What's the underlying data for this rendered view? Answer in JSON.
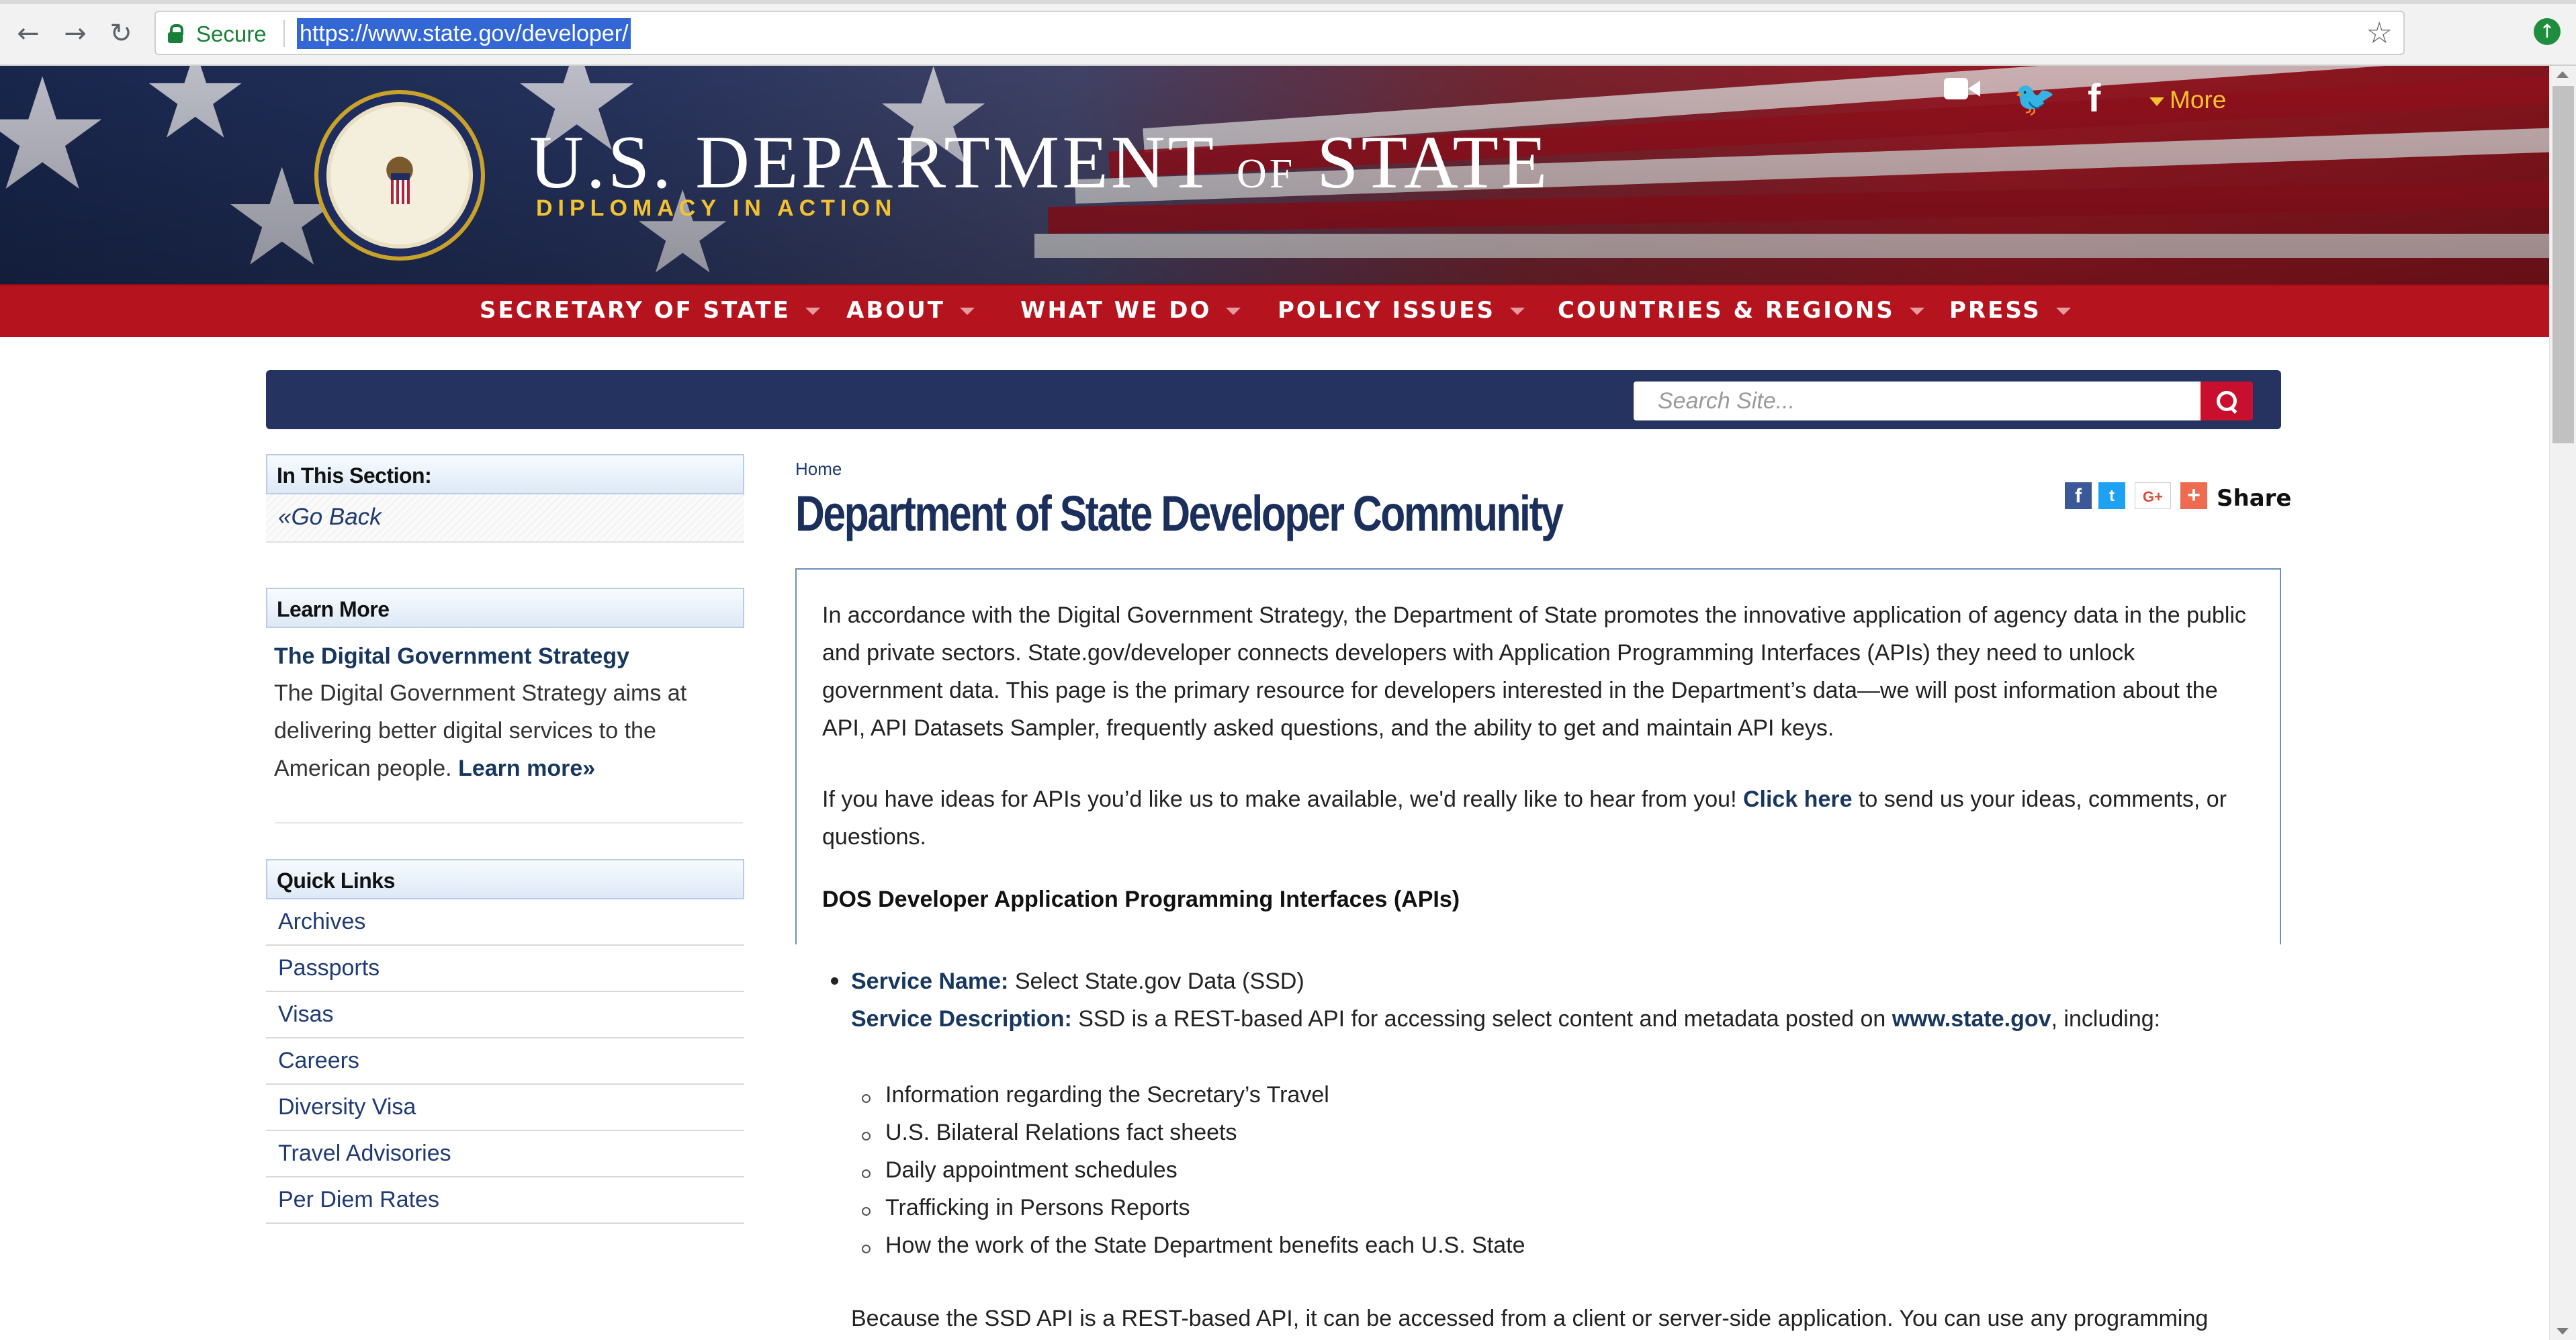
{
  "browser": {
    "secure_label": "Secure",
    "url": "https://www.state.gov/developer/"
  },
  "header": {
    "title_main_1": "U.S. DEPARTMENT",
    "title_of": "OF",
    "title_main_2": "STATE",
    "tagline": "DIPLOMACY IN ACTION",
    "more_label": "More",
    "social_icons": [
      "video-icon",
      "twitter-icon",
      "facebook-icon"
    ]
  },
  "nav": {
    "items": [
      {
        "label": "SECRETARY OF STATE"
      },
      {
        "label": "ABOUT"
      },
      {
        "label": "WHAT WE DO"
      },
      {
        "label": "POLICY ISSUES"
      },
      {
        "label": "COUNTRIES & REGIONS"
      },
      {
        "label": "PRESS"
      }
    ]
  },
  "search": {
    "placeholder": "Search Site..."
  },
  "sidebar": {
    "section_title": "In This Section:",
    "go_back": "Go Back",
    "learn_more": {
      "header": "Learn More",
      "title": "The Digital Government Strategy",
      "body": "The Digital Government Strategy aims at delivering better digital services to the American people.",
      "link": "Learn more»"
    },
    "quick_links": {
      "header": "Quick Links",
      "items": [
        {
          "label": "Archives"
        },
        {
          "label": "Passports"
        },
        {
          "label": "Visas"
        },
        {
          "label": "Careers"
        },
        {
          "label": "Diversity Visa"
        },
        {
          "label": "Travel Advisories"
        },
        {
          "label": "Per Diem Rates"
        }
      ]
    }
  },
  "main": {
    "breadcrumb": "Home",
    "title": "Department of State Developer Community",
    "share_label": "Share",
    "intro_paragraph": "In accordance with the Digital Government Strategy, the Department of State promotes the innovative application of agency data in the public and private sectors. State.gov/developer connects developers with Application Programming Interfaces (APIs) they need to unlock government data. This page is the primary resource for developers interested in the Department’s data—we will post information about the API, API Datasets Sampler, frequently asked questions, and the ability to get and maintain API keys.",
    "ideas_before": "If you have ideas for APIs you’d like us to make available, we'd really like to hear from you!",
    "ideas_link": "Click here",
    "ideas_after": "to send us your ideas, comments, or questions.",
    "apis_heading": "DOS Developer Application Programming Interfaces (APIs)",
    "service": {
      "name_label": "Service Name:",
      "name_value": "Select State.gov Data (SSD)",
      "desc_label": "Service Description:",
      "desc_value": "SSD is a REST-based API for accessing select content and metadata posted on",
      "desc_link": "www.state.gov",
      "desc_after": ", including:",
      "items": [
        "Information regarding the Secretary’s Travel",
        "U.S. Bilateral Relations fact sheets",
        "Daily appointment schedules",
        "Trafficking in Persons Reports",
        "How the work of the State Department benefits each U.S. State"
      ]
    },
    "bottom_paragraph": "Because the SSD API is a REST-based API, it can be accessed from a client or server-side application. You can use any programming"
  }
}
